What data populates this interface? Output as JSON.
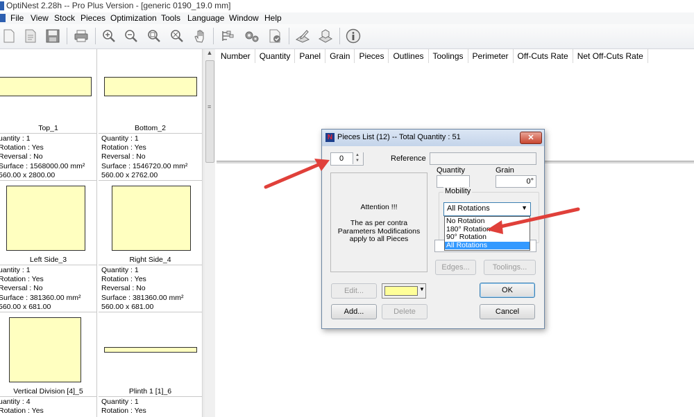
{
  "window": {
    "title": "OptiNest 2.28h -- Pro Plus Version - [generic 0190_19.0 mm]"
  },
  "menu": {
    "items": [
      "File",
      "View",
      "Stock",
      "Pieces",
      "Optimization",
      "Tools",
      "Language",
      "Window",
      "Help"
    ]
  },
  "toolbar": {
    "buttons": [
      "new-icon",
      "open-icon",
      "save-icon",
      "print-icon",
      "zoom-in-icon",
      "zoom-out-icon",
      "zoom-window-icon",
      "zoom-fit-icon",
      "pan-hand-icon",
      "optimize-icon",
      "settings-icon",
      "validate-icon",
      "edit-pieces-icon",
      "stock-icon",
      "info-icon"
    ]
  },
  "pieces_panel": {
    "pieces": [
      {
        "name": "Top_1",
        "quantity": "uantity : 1",
        "rotation": "Rotation : Yes",
        "reversal": "Reversal : No",
        "surface": "Surface : 1568000.00 mm²",
        "dims": "560.00  x  2800.00"
      },
      {
        "name": "Bottom_2",
        "quantity": "Quantity : 1",
        "rotation": "Rotation : Yes",
        "reversal": "Reversal : No",
        "surface": "Surface : 1546720.00 mm²",
        "dims": "560.00  x  2762.00"
      },
      {
        "name": "Left Side_3",
        "quantity": "uantity : 1",
        "rotation": "Rotation : Yes",
        "reversal": "Reversal : No",
        "surface": "Surface : 381360.00 mm²",
        "dims": "560.00  x  681.00"
      },
      {
        "name": "Right Side_4",
        "quantity": "Quantity : 1",
        "rotation": "Rotation : Yes",
        "reversal": "Reversal : No",
        "surface": "Surface : 381360.00 mm²",
        "dims": "560.00  x  681.00"
      },
      {
        "name": "Vertical Division [4]_5",
        "quantity": "uantity : 4",
        "rotation": "Rotation : Yes"
      },
      {
        "name": "Plinth 1 [1]_6",
        "quantity": "Quantity : 1",
        "rotation": "Rotation : Yes"
      }
    ]
  },
  "results_table": {
    "columns": [
      "Number",
      "Quantity",
      "Panel",
      "Grain",
      "Pieces",
      "Outlines",
      "Toolings",
      "Perimeter",
      "Off-Cuts Rate",
      "Net Off-Cuts Rate"
    ]
  },
  "dialog": {
    "title": "Pieces List (12) -- Total Quantity : 51",
    "close_label": "✕",
    "index_value": "0",
    "reference_label": "Reference",
    "reference_value": "",
    "quantity_label": "Quantity",
    "quantity_value": "",
    "grain_label": "Grain",
    "grain_value": "0°",
    "notice_title": "Attention !!!",
    "notice_body": "The as per contra Parameters Modifications apply to all Pieces",
    "mobility_label": "Mobility",
    "mobility_selected": "All Rotations",
    "mobility_options": [
      "No Rotation",
      "180° Rotation",
      "90° Rotation",
      "All Rotations"
    ],
    "edges_label": "Edges...",
    "toolings_label": "Toolings...",
    "edit_label": "Edit...",
    "color_value": "#ffff99",
    "ok_label": "OK",
    "add_label": "Add...",
    "delete_label": "Delete",
    "cancel_label": "Cancel"
  },
  "colors": {
    "piece_fill": "#ffffc0",
    "annotation_arrow": "#e0403a",
    "selection": "#3399ff"
  }
}
